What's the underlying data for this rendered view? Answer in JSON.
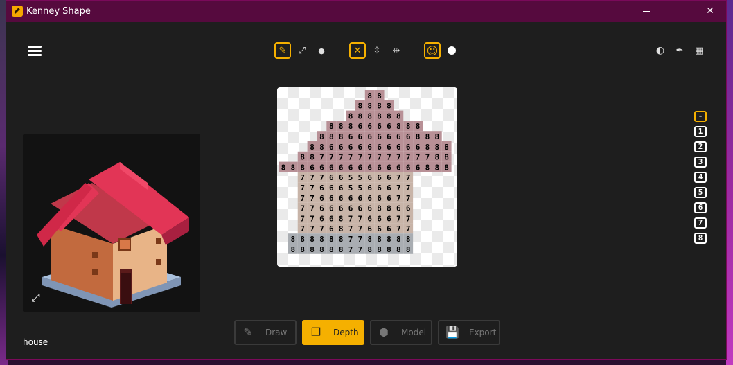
{
  "window": {
    "title": "Kenney Shape",
    "controls": {
      "minimize": "",
      "maximize": "",
      "close": "✕"
    }
  },
  "toolbar": {
    "menu_icon": "hamburger-menu-icon",
    "groups": [
      {
        "tools": [
          {
            "name": "pencil",
            "icon": "✎",
            "active": true
          },
          {
            "name": "line",
            "icon": "⤢",
            "active": false
          },
          {
            "name": "fill",
            "icon": "●",
            "active": false
          }
        ]
      },
      {
        "tools": [
          {
            "name": "mirror-off",
            "icon": "✕",
            "active": true
          },
          {
            "name": "mirror-vertical",
            "icon": "⇳",
            "active": false
          },
          {
            "name": "mirror-horizontal",
            "icon": "⇹",
            "active": false
          }
        ]
      },
      {
        "tools": [
          {
            "name": "smiley",
            "icon": "☺",
            "active": true
          },
          {
            "name": "color-dot",
            "icon": "",
            "active": false
          }
        ]
      }
    ],
    "right_tools": [
      {
        "name": "brightness",
        "icon": "◐"
      },
      {
        "name": "eyedropper",
        "icon": "✒"
      },
      {
        "name": "checker",
        "icon": "▦"
      }
    ]
  },
  "preview": {
    "label": "house",
    "expand_icon": "⤢"
  },
  "grid": {
    "cols": 18,
    "rows": 18,
    "roof_color": "#b89096",
    "wall_color": "#c8b4a8",
    "base_color": "#a9adb2",
    "rows_data": [
      "         88       ",
      "        8888      ",
      "       888888     ",
      "     8886666888   ",
      "    8886666666888 ",
      "   886666666666888",
      "  88777777777777888",
      "888666666666666888",
      "  777665566677    ",
      "  776665566677    ",
      "  776666666677    ",
      "  776666668866    ",
      "  776687766677    ",
      "  777687766677    ",
      " 8888887788888    ",
      " 8888887788888    "
    ]
  },
  "layers": {
    "active": "-",
    "items": [
      "-",
      "1",
      "2",
      "3",
      "4",
      "5",
      "6",
      "7",
      "8"
    ]
  },
  "bottom_bar": {
    "buttons": [
      {
        "label": "Draw",
        "icon": "✎",
        "active": false
      },
      {
        "label": "Depth",
        "icon": "❐",
        "active": true
      },
      {
        "label": "Model",
        "icon": "⬢",
        "active": false
      },
      {
        "label": "Export",
        "icon": "💾",
        "active": false
      }
    ]
  },
  "colors": {
    "accent": "#f5b000",
    "titlebar": "#560a3e",
    "background": "#1e1e1e"
  }
}
